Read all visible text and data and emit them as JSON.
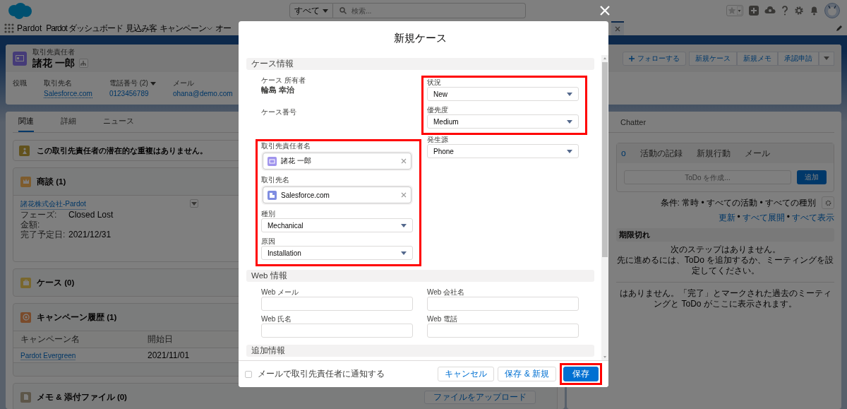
{
  "global_header": {
    "search_scope": "すべて",
    "search_placeholder": "検索..."
  },
  "nav": {
    "app_name": "Pardot",
    "items": [
      {
        "label": "Pardot ダッシュボード",
        "dropdown": false
      },
      {
        "label": "見込み客",
        "dropdown": false
      },
      {
        "label": "キャンペーン",
        "dropdown": true
      },
      {
        "label": "オー",
        "dropdown": false
      }
    ]
  },
  "record": {
    "object_type": "取引先責任者",
    "name": "諸花 一郎",
    "actions": [
      {
        "kind": "follow",
        "label": "フォローする"
      },
      {
        "kind": "plain",
        "label": "新規ケース"
      },
      {
        "kind": "plain",
        "label": "新規メモ"
      },
      {
        "kind": "plain",
        "label": "承認申請"
      },
      {
        "kind": "more"
      }
    ],
    "fields": [
      {
        "kind": "plain",
        "label": "役職"
      },
      {
        "kind": "link",
        "label": "取引先名",
        "value": "Salesforce.com"
      },
      {
        "kind": "dropdown",
        "label": "電話番号 (2)",
        "value": "0123456789"
      },
      {
        "kind": "plain",
        "label": "メール",
        "value": "ohana@demo.com"
      }
    ]
  },
  "related_tabs": [
    {
      "label": "関連",
      "selected": true
    },
    {
      "label": "詳細",
      "selected": false
    },
    {
      "label": "ニュース",
      "selected": false
    }
  ],
  "related": {
    "notice": "この取引先責任者の潜在的な重複はありません。",
    "cards": [
      {
        "kind": "opportunity",
        "title": "商談 (1)",
        "item": {
          "link": "諸花株式会社-Pardot",
          "fields": [
            {
              "label": "フェーズ:",
              "value": "Closed Lost"
            },
            {
              "label": "金額:"
            },
            {
              "label": "完了予定日:",
              "value": "2021/12/31"
            }
          ]
        }
      },
      {
        "kind": "case",
        "title": "ケース (0)"
      },
      {
        "kind": "campaign",
        "title": "キャンペーン履歴 (1)",
        "table": {
          "columns": [
            "キャンペーン名",
            "開始日"
          ],
          "rows": [
            [
              {
                "text": "Pardot Evergreen",
                "link": true
              },
              {
                "text": "2021/11/01",
                "link": false
              }
            ]
          ]
        }
      },
      {
        "kind": "file",
        "title": "メモ & 添付ファイル (0)",
        "button": "ファイルをアップロード"
      }
    ]
  },
  "activity": {
    "panel_tabs": [
      {
        "label": "Chatter"
      }
    ],
    "composer_tabs": [
      {
        "label": "o",
        "selected": true
      },
      {
        "label": "活動の記録",
        "selected": false
      },
      {
        "label": "新規行動",
        "selected": false
      },
      {
        "label": "メール",
        "selected": false
      }
    ],
    "todo_placeholder": "ToDo を作成...",
    "add_button": "追加",
    "filter": "条件: 常時 • すべての活動 • すべての種別",
    "links": [
      "更新",
      "すべて展開",
      "すべて表示"
    ],
    "link_separator": "•",
    "overdue_header": "期限切れ",
    "next_steps": [
      "次のステップはありません。",
      "先に進めるには、ToDo を追加するか、ミーティングを設定してください。"
    ],
    "past_note": "はありません。「完了」とマークされた過去のミーティングと ToDo がここに表示されます。"
  },
  "modal": {
    "title": "新規ケース",
    "sections": [
      {
        "title": "ケース情報",
        "columns": [
          [
            {
              "kind": "readonly",
              "label": "ケース 所有者",
              "value": "輪島 幸治",
              "highlighted": false
            },
            {
              "kind": "readonly",
              "label": "ケース番号",
              "highlighted": false
            },
            {
              "kind": "contact_lookup",
              "label": "取引先責任者名",
              "value": "諸花 一郎",
              "highlighted": true
            },
            {
              "kind": "account_lookup",
              "label": "取引先名",
              "value": "Salesforce.com",
              "highlighted": true
            },
            {
              "kind": "picklist",
              "label": "種別",
              "value": "Mechanical",
              "highlighted": true
            },
            {
              "kind": "picklist",
              "label": "原因",
              "value": "Installation",
              "highlighted": true
            }
          ],
          [
            {
              "kind": "picklist",
              "label": "状況",
              "value": "New",
              "highlighted": true
            },
            {
              "kind": "picklist",
              "label": "優先度",
              "value": "Medium",
              "highlighted": true
            },
            {
              "kind": "picklist",
              "label": "発生源",
              "value": "Phone",
              "highlighted": false
            }
          ]
        ]
      },
      {
        "title": "Web 情報",
        "columns": [
          [
            {
              "kind": "text",
              "label": "Web メール",
              "highlighted": false
            },
            {
              "kind": "text",
              "label": "Web 氏名",
              "highlighted": false
            }
          ],
          [
            {
              "kind": "text",
              "label": "Web 会社名",
              "highlighted": false
            },
            {
              "kind": "text",
              "label": "Web 電話",
              "highlighted": false
            }
          ]
        ]
      },
      {
        "title": "追加情報"
      }
    ],
    "notify": {
      "label": "メールで取引先責任者に通知する",
      "checked": false
    },
    "buttons": [
      {
        "kind": "neutral",
        "label": "キャンセル",
        "highlighted": false
      },
      {
        "kind": "neutral",
        "label": "保存 & 新規",
        "highlighted": false
      },
      {
        "kind": "brand",
        "label": "保存",
        "highlighted": true
      }
    ]
  }
}
